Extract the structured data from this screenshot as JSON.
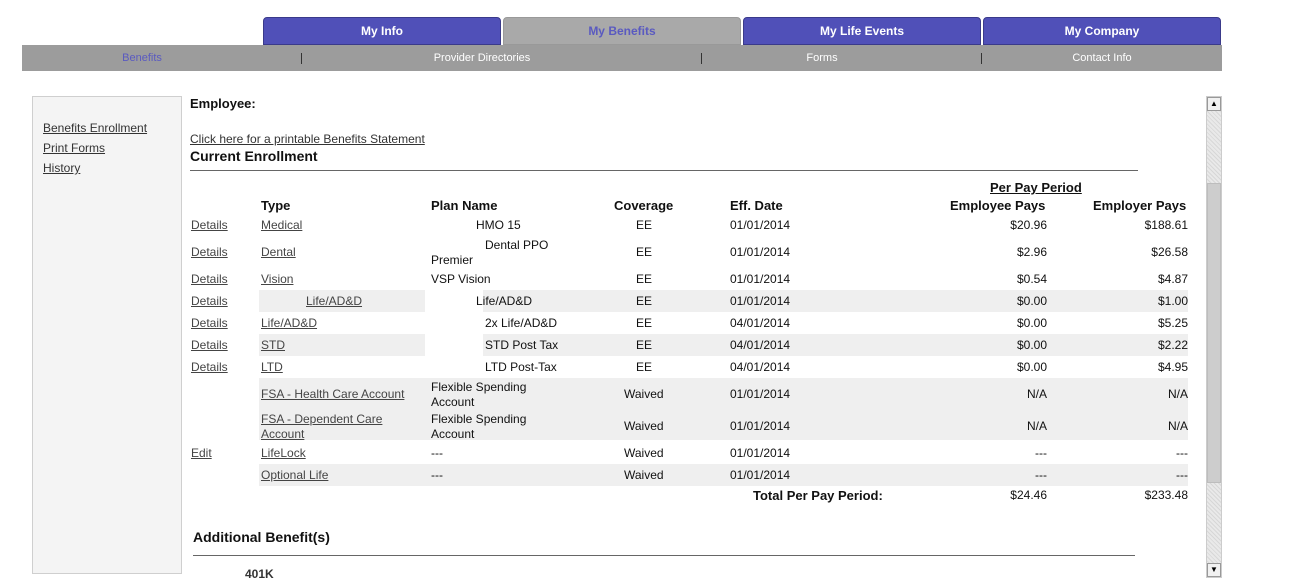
{
  "tabs": [
    {
      "label": "My Info",
      "active": false
    },
    {
      "label": "My Benefits",
      "active": true
    },
    {
      "label": "My Life Events",
      "active": false
    },
    {
      "label": "My Company",
      "active": false
    }
  ],
  "subnav": [
    {
      "label": "Benefits",
      "active": true
    },
    {
      "label": "Provider Directories",
      "active": false
    },
    {
      "label": "Forms",
      "active": false
    },
    {
      "label": "Contact Info",
      "active": false
    }
  ],
  "sidebar": {
    "items": [
      "Benefits Enrollment",
      "Print Forms",
      "History"
    ]
  },
  "main": {
    "employee_label": "Employee:",
    "printable_link": "Click here for a printable Benefits Statement",
    "current_enrollment_title": "Current Enrollment",
    "per_pay_period": "Per Pay Period",
    "headers": {
      "type": "Type",
      "plan_name": "Plan Name",
      "coverage": "Coverage",
      "eff_date": "Eff. Date",
      "employee_pays": "Employee Pays",
      "employer_pays": "Employer Pays"
    },
    "rows": [
      {
        "action": "Details",
        "type": "Medical",
        "plan": "HMO 15",
        "plan2": "",
        "coverage": "EE",
        "eff": "01/01/2014",
        "employee": "$20.96",
        "employer": "$188.61"
      },
      {
        "action": "Details",
        "type": "Dental",
        "plan": "Dental PPO",
        "plan2": "Premier",
        "coverage": "EE",
        "eff": "01/01/2014",
        "employee": "$2.96",
        "employer": "$26.58"
      },
      {
        "action": "Details",
        "type": "Vision",
        "plan": "VSP Vision",
        "plan2": "",
        "coverage": "EE",
        "eff": "01/01/2014",
        "employee": "$0.54",
        "employer": "$4.87"
      },
      {
        "action": "Details",
        "type": "Life/AD&D",
        "plan": "Life/AD&D",
        "plan2": "",
        "coverage": "EE",
        "eff": "01/01/2014",
        "employee": "$0.00",
        "employer": "$1.00"
      },
      {
        "action": "Details",
        "type": "Life/AD&D",
        "plan": "2x Life/AD&D",
        "plan2": "",
        "coverage": "EE",
        "eff": "04/01/2014",
        "employee": "$0.00",
        "employer": "$5.25"
      },
      {
        "action": "Details",
        "type": "STD",
        "plan": "STD Post Tax",
        "plan2": "",
        "coverage": "EE",
        "eff": "04/01/2014",
        "employee": "$0.00",
        "employer": "$2.22"
      },
      {
        "action": "Details",
        "type": "LTD",
        "plan": "LTD Post-Tax",
        "plan2": "",
        "coverage": "EE",
        "eff": "04/01/2014",
        "employee": "$0.00",
        "employer": "$4.95"
      },
      {
        "action": "",
        "type": "FSA - Health Care Account",
        "type2": "",
        "plan": "Flexible Spending",
        "plan2": "Account",
        "coverage": "Waived",
        "eff": "01/01/2014",
        "employee": "N/A",
        "employer": "N/A"
      },
      {
        "action": "",
        "type": "FSA - Dependent Care",
        "type2": "Account",
        "plan": "Flexible Spending",
        "plan2": "Account",
        "coverage": "Waived",
        "eff": "01/01/2014",
        "employee": "N/A",
        "employer": "N/A"
      },
      {
        "action": "Edit",
        "type": "LifeLock",
        "plan": "---",
        "plan2": "",
        "coverage": "Waived",
        "eff": "01/01/2014",
        "employee": "---",
        "employer": "---"
      },
      {
        "action": "",
        "type": "Optional Life",
        "plan": "---",
        "plan2": "",
        "coverage": "Waived",
        "eff": "01/01/2014",
        "employee": "---",
        "employer": "---"
      }
    ],
    "total_label": "Total Per Pay Period:",
    "total_employee": "$24.46",
    "total_employer": "$233.48",
    "additional_title": "Additional Benefit(s)",
    "additional_first": "401K"
  },
  "scrollbar": {
    "up_icon": "▲",
    "down_icon": "▼"
  }
}
